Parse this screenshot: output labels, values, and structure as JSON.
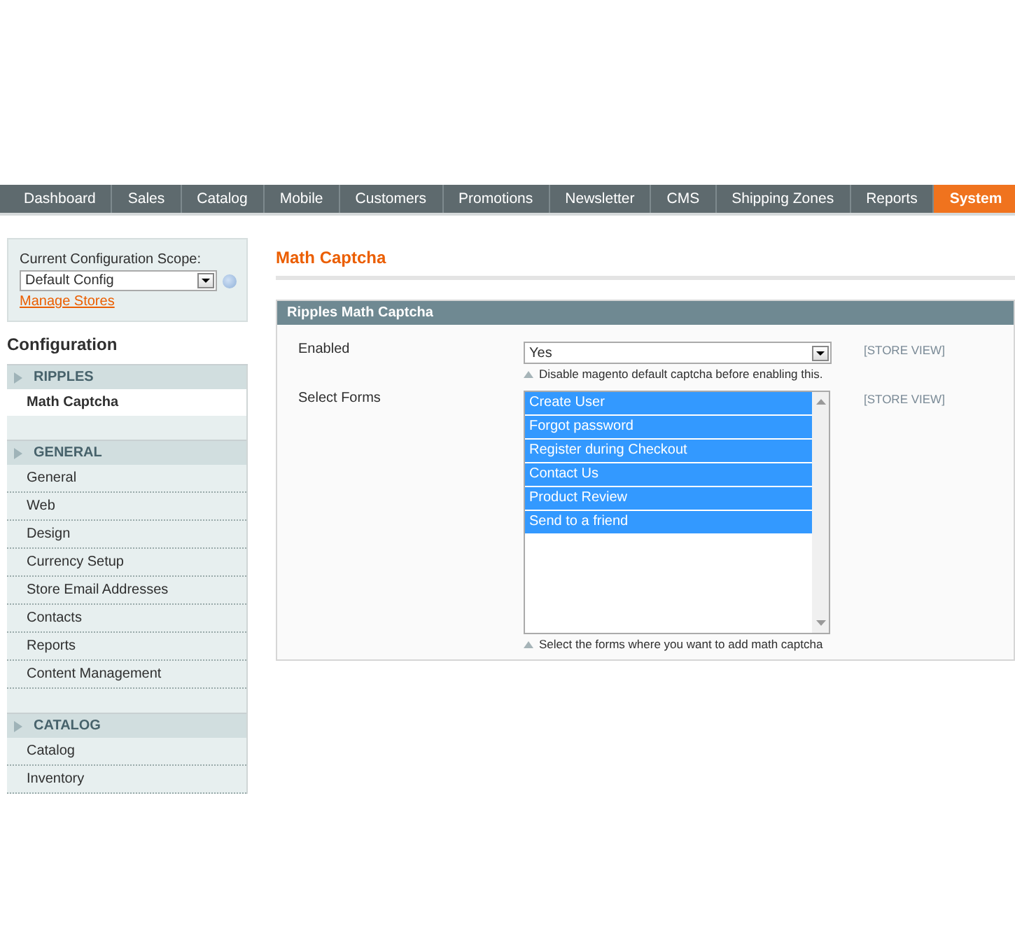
{
  "nav": [
    {
      "label": "Dashboard",
      "selected": false
    },
    {
      "label": "Sales",
      "selected": false
    },
    {
      "label": "Catalog",
      "selected": false
    },
    {
      "label": "Mobile",
      "selected": false
    },
    {
      "label": "Customers",
      "selected": false
    },
    {
      "label": "Promotions",
      "selected": false
    },
    {
      "label": "Newsletter",
      "selected": false
    },
    {
      "label": "CMS",
      "selected": false
    },
    {
      "label": "Shipping Zones",
      "selected": false
    },
    {
      "label": "Reports",
      "selected": false
    },
    {
      "label": "System",
      "selected": true
    }
  ],
  "scope": {
    "label": "Current Configuration Scope:",
    "value": "Default Config",
    "link": "Manage Stores"
  },
  "sidebar": {
    "title": "Configuration",
    "sections": [
      {
        "label": "RIPPLES",
        "items": [
          {
            "label": "Math Captcha",
            "selected": true
          }
        ]
      },
      {
        "label": "GENERAL",
        "items": [
          {
            "label": "General",
            "selected": false
          },
          {
            "label": "Web",
            "selected": false
          },
          {
            "label": "Design",
            "selected": false
          },
          {
            "label": "Currency Setup",
            "selected": false
          },
          {
            "label": "Store Email Addresses",
            "selected": false
          },
          {
            "label": "Contacts",
            "selected": false
          },
          {
            "label": "Reports",
            "selected": false
          },
          {
            "label": "Content Management",
            "selected": false
          }
        ]
      },
      {
        "label": "CATALOG",
        "items": [
          {
            "label": "Catalog",
            "selected": false
          },
          {
            "label": "Inventory",
            "selected": false
          }
        ]
      }
    ]
  },
  "page_title": "Math Captcha",
  "fieldset": {
    "title": "Ripples Math Captcha",
    "fields": [
      {
        "kind": "select",
        "label": "Enabled",
        "value": "Yes",
        "note": "Disable magento default captcha before enabling this.",
        "scope": "[STORE VIEW]"
      },
      {
        "kind": "multiselect",
        "label": "Select Forms",
        "options": [
          {
            "label": "Create User",
            "selected": true
          },
          {
            "label": "Forgot password",
            "selected": true
          },
          {
            "label": "Register during Checkout",
            "selected": true
          },
          {
            "label": "Contact Us",
            "selected": true
          },
          {
            "label": "Product Review",
            "selected": true
          },
          {
            "label": "Send to a friend",
            "selected": true
          }
        ],
        "note": "Select the forms where you want to add math captcha",
        "scope": "[STORE VIEW]"
      }
    ]
  }
}
